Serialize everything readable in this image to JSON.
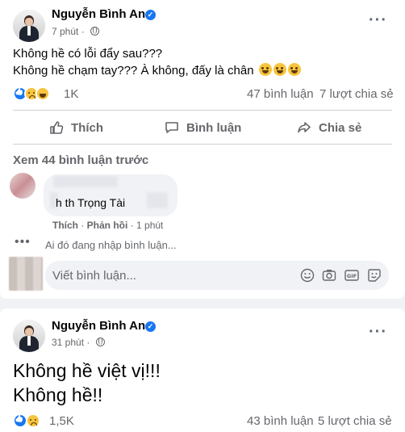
{
  "post1": {
    "author": "Nguyễn Bình An",
    "time": "7 phút",
    "lines": [
      "Không hề có lỗi đẩy sau???",
      "Không hề chạm tay??? À không, đấy là chân"
    ],
    "reaction_count": "1K",
    "comments_count": "47 bình luận",
    "shares_count": "7 lượt chia sẻ",
    "actions": {
      "like": "Thích",
      "comment": "Bình luận",
      "share": "Chia sẻ"
    },
    "view_previous": "Xem 44 bình luận trước",
    "comment": {
      "text": "h th Trọng Tài",
      "like": "Thích",
      "reply": "Phản hồi",
      "time": "1 phút"
    },
    "typing": "Ai đó đang nhập bình luận...",
    "write_placeholder": "Viết bình luận..."
  },
  "post2": {
    "author": "Nguyễn Bình An",
    "time": "31 phút",
    "lines": [
      "Không hề việt vị!!!",
      "Không hề!!"
    ],
    "reaction_count": "1,5K",
    "comments_count": "43 bình luận",
    "shares_count": "5 lượt chia sẻ"
  },
  "colors": {
    "accent": "#1877f2",
    "muted": "#65676b",
    "background": "#f0f2f5"
  }
}
